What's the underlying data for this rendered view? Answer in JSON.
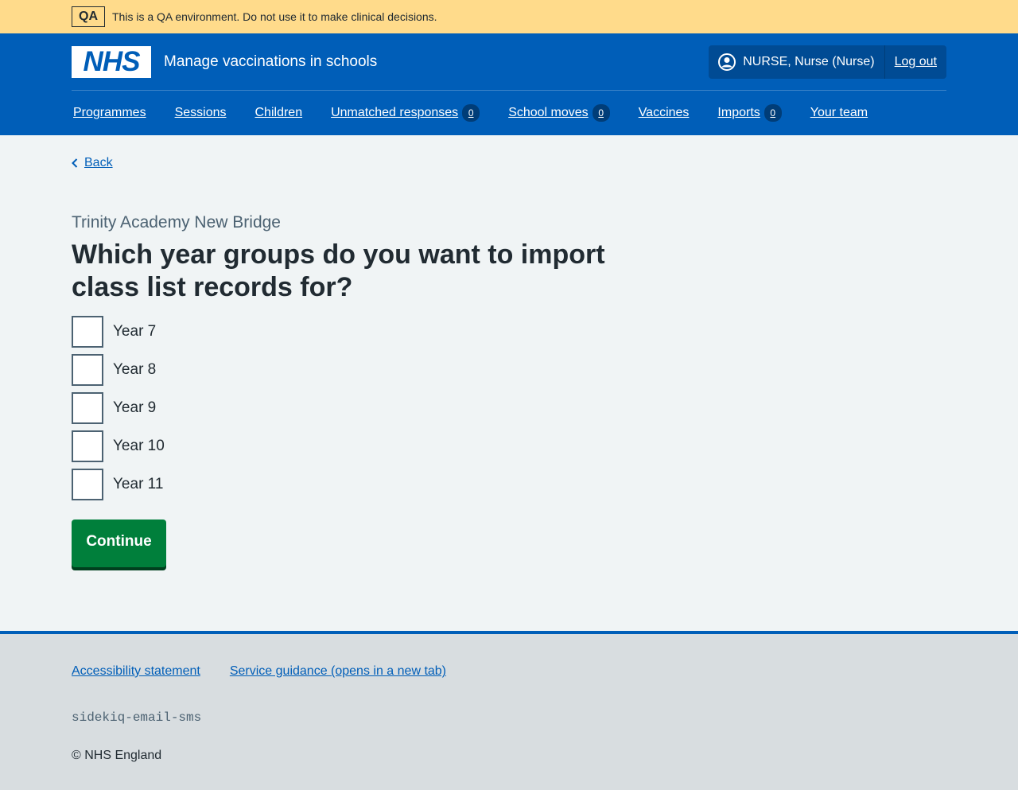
{
  "env_banner": {
    "tag": "QA",
    "text": "This is a QA environment. Do not use it to make clinical decisions."
  },
  "header": {
    "logo": "NHS",
    "service_name": "Manage vaccinations in schools",
    "user": "NURSE, Nurse (Nurse)",
    "logout": "Log out"
  },
  "nav": [
    {
      "label": "Programmes"
    },
    {
      "label": "Sessions"
    },
    {
      "label": "Children"
    },
    {
      "label": "Unmatched responses",
      "badge": "0"
    },
    {
      "label": "School moves",
      "badge": "0"
    },
    {
      "label": "Vaccines"
    },
    {
      "label": "Imports",
      "badge": "0"
    },
    {
      "label": "Your team"
    }
  ],
  "main": {
    "back": "Back",
    "caption": "Trinity Academy New Bridge",
    "heading": "Which year groups do you want to import class list records for?",
    "options": [
      {
        "label": "Year 7",
        "checked": false
      },
      {
        "label": "Year 8",
        "checked": false
      },
      {
        "label": "Year 9",
        "checked": false
      },
      {
        "label": "Year 10",
        "checked": false
      },
      {
        "label": "Year 11",
        "checked": false
      }
    ],
    "continue": "Continue"
  },
  "footer": {
    "links": [
      "Accessibility statement",
      "Service guidance (opens in a new tab)"
    ],
    "code": "sidekiq-email-sms",
    "copyright": "© NHS England"
  }
}
